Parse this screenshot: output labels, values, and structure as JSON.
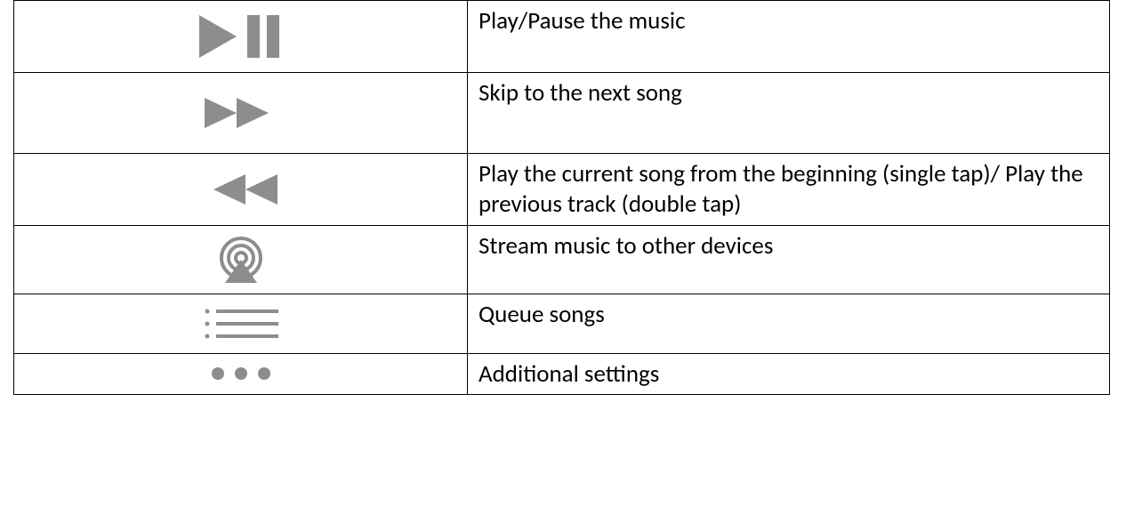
{
  "rows": [
    {
      "icon": "play-pause",
      "desc": "Play/Pause the music"
    },
    {
      "icon": "skip-next",
      "desc": "Skip to the next song"
    },
    {
      "icon": "skip-prev",
      "desc": "Play the current song from the beginning (single tap)/ Play the previous track (double tap)"
    },
    {
      "icon": "airplay",
      "desc": "Stream music to other devices"
    },
    {
      "icon": "queue-list",
      "desc": "Queue songs"
    },
    {
      "icon": "more-dots",
      "desc": "Additional settings"
    }
  ]
}
